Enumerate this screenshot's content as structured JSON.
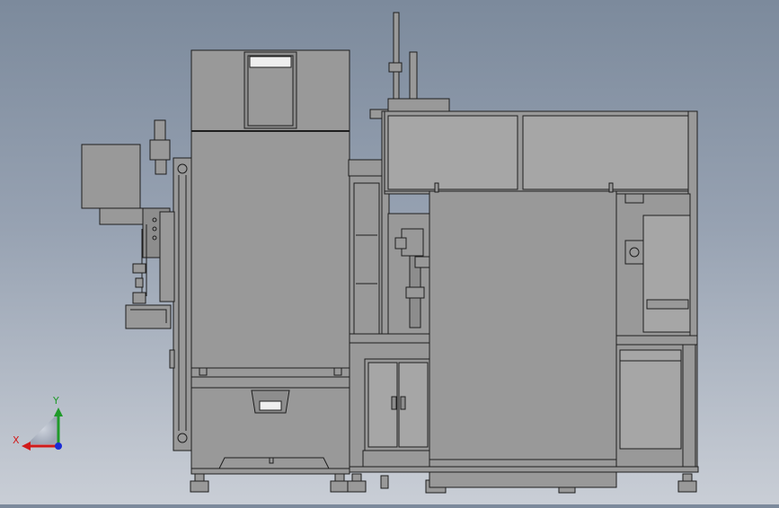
{
  "viewport": {
    "background_top": "#7c8a9c",
    "background_bottom": "#c9ced6",
    "part_fill": "#999999",
    "part_fill_light": "#a6a6a6",
    "edge_color": "#1e1e1e"
  },
  "triad": {
    "x_label": "X",
    "y_label": "Y",
    "x_color": "#d11b1b",
    "y_color": "#1f9a2a",
    "z_color": "#1a2bd6"
  }
}
